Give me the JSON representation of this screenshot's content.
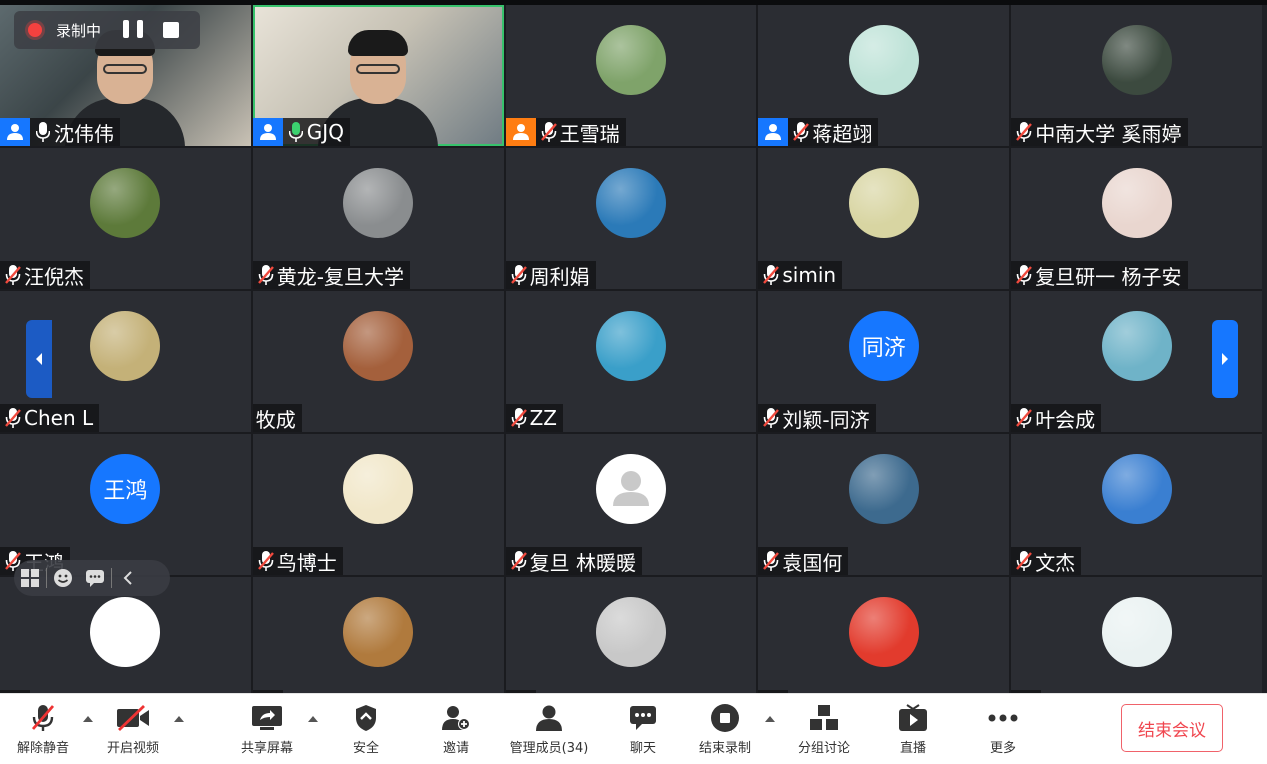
{
  "recording": {
    "label": "录制中"
  },
  "participants": [
    {
      "name": "沈伟伟",
      "host": "host",
      "mic": "on",
      "kind": "video",
      "variant": "v1"
    },
    {
      "name": "GJQ",
      "host": "host",
      "mic": "speaking",
      "kind": "video",
      "variant": "v2",
      "active": true
    },
    {
      "name": "王雪瑞",
      "host": "cohost",
      "mic": "muted",
      "kind": "photo",
      "bg": "#7fa36a"
    },
    {
      "name": "蒋超翊",
      "host": "host",
      "mic": "muted",
      "kind": "photo",
      "bg": "#bfe3d8"
    },
    {
      "name": "中南大学 奚雨婷",
      "mic": "muted",
      "kind": "photo",
      "bg": "#3c4a3f"
    },
    {
      "name": "汪倪杰",
      "mic": "muted",
      "kind": "photo",
      "bg": "#5d7a3a"
    },
    {
      "name": "黄龙-复旦大学",
      "mic": "muted",
      "kind": "photo",
      "bg": "#8a8d8f"
    },
    {
      "name": "周利娟",
      "mic": "muted",
      "kind": "photo",
      "bg": "#2b7ab8"
    },
    {
      "name": "simin",
      "mic": "muted",
      "kind": "photo",
      "bg": "#d8d5a2"
    },
    {
      "name": "复旦研一 杨子安",
      "mic": "muted",
      "kind": "photo",
      "bg": "#e9d6cf"
    },
    {
      "name": "Chen L",
      "mic": "muted",
      "kind": "photo",
      "bg": "#c4b178"
    },
    {
      "name": "牧成",
      "mic": "none",
      "kind": "photo",
      "bg": "#a4603c"
    },
    {
      "name": "ZZ",
      "mic": "muted",
      "kind": "photo",
      "bg": "#3a9fc9"
    },
    {
      "name": "刘颖-同济",
      "mic": "muted",
      "kind": "text",
      "avatar_text": "同济"
    },
    {
      "name": "叶会成",
      "mic": "muted",
      "kind": "photo",
      "bg": "#6fb3c8"
    },
    {
      "name": "王鸿",
      "mic": "muted",
      "kind": "text",
      "avatar_text": "王鸿"
    },
    {
      "name": "鸟博士",
      "mic": "muted",
      "kind": "photo",
      "bg": "#f1e7c9"
    },
    {
      "name": "复旦 林暖暖",
      "mic": "muted",
      "kind": "default"
    },
    {
      "name": "袁国何",
      "mic": "muted",
      "kind": "photo",
      "bg": "#3d6a8e"
    },
    {
      "name": "文杰",
      "mic": "muted",
      "kind": "photo",
      "bg": "#3a7fd1"
    },
    {
      "name": "",
      "mic": "muted",
      "kind": "photo",
      "bg": "#ffffff"
    },
    {
      "name": "",
      "mic": "muted",
      "kind": "photo",
      "bg": "#b07a3d"
    },
    {
      "name": "",
      "mic": "muted",
      "kind": "photo",
      "bg": "#c8c8c8"
    },
    {
      "name": "",
      "mic": "muted",
      "kind": "photo",
      "bg": "#e23b2d"
    },
    {
      "name": "",
      "mic": "muted",
      "kind": "photo",
      "bg": "#eaf2f2"
    }
  ],
  "toolbar": {
    "unmute": "解除静音",
    "start_video": "开启视频",
    "share_screen": "共享屏幕",
    "security": "安全",
    "invite": "邀请",
    "manage_members": "管理成员(34)",
    "chat": "聊天",
    "stop_recording": "结束录制",
    "breakout": "分组讨论",
    "live": "直播",
    "more": "更多",
    "end_meeting": "结束会议"
  }
}
